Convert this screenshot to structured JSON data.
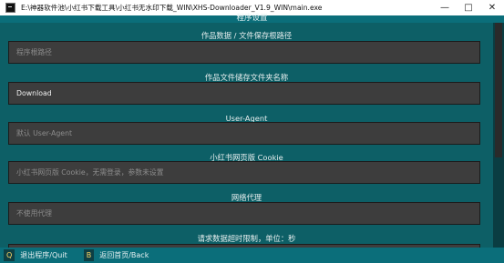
{
  "window": {
    "title": "E:\\神器软件池\\小红书下载工具\\小红书无水印下载_WIN\\XHS-Downloader_V1.9_WIN\\main.exe",
    "controls": [
      "—",
      "□",
      "✕"
    ]
  },
  "header": {
    "title": "程序设置"
  },
  "sections": [
    {
      "label": "作品数据 / 文件保存根路径",
      "placeholder": "程序根路径",
      "value": ""
    },
    {
      "label": "作品文件储存文件夹名称",
      "placeholder": "",
      "value": "Download"
    },
    {
      "label": "User-Agent",
      "placeholder": "默认 User-Agent",
      "value": ""
    },
    {
      "label": "小红书网页版 Cookie",
      "placeholder": "小红书网页版 Cookie，无需登录，参数未设置",
      "value": ""
    },
    {
      "label": "网络代理",
      "placeholder": "不使用代理",
      "value": ""
    },
    {
      "label": "请求数据超时限制，单位：秒",
      "placeholder": "",
      "value": ""
    }
  ],
  "footer": {
    "items": [
      {
        "key": "Q",
        "label": "退出程序/Quit"
      },
      {
        "key": "B",
        "label": "返回首页/Back"
      }
    ]
  },
  "colors": {
    "header_bg": "#0b6e7a",
    "content_bg": "#0d5f66",
    "field_bg": "#3d3d3d",
    "key_color": "#ffd966"
  }
}
